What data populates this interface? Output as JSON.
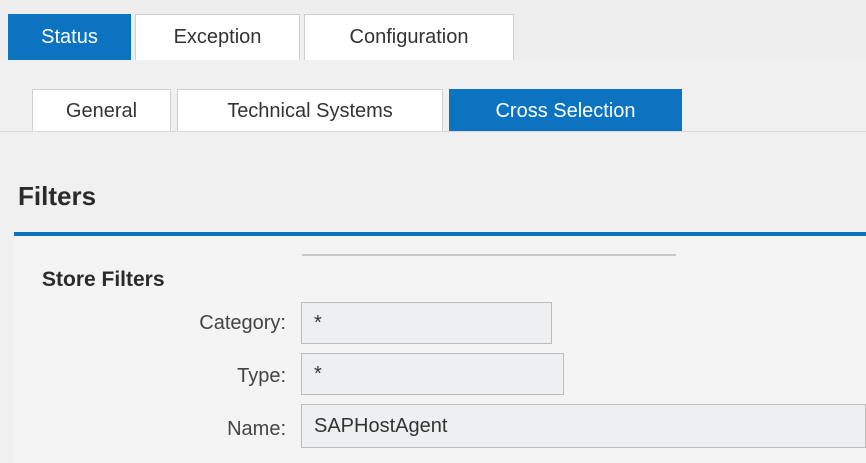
{
  "top_tabs": [
    {
      "label": "Status",
      "active": true
    },
    {
      "label": "Exception",
      "active": false
    },
    {
      "label": "Configuration",
      "active": false
    }
  ],
  "sub_tabs": [
    {
      "label": "General",
      "active": false
    },
    {
      "label": "Technical Systems",
      "active": false
    },
    {
      "label": "Cross Selection",
      "active": true
    }
  ],
  "filters": {
    "title": "Filters",
    "section_title": "Store Filters",
    "fields": [
      {
        "label": "Category:",
        "value": "*"
      },
      {
        "label": "Type:",
        "value": "*"
      },
      {
        "label": "Name:",
        "value": "SAPHostAgent"
      }
    ]
  },
  "colors": {
    "accent": "#0b73bf"
  }
}
